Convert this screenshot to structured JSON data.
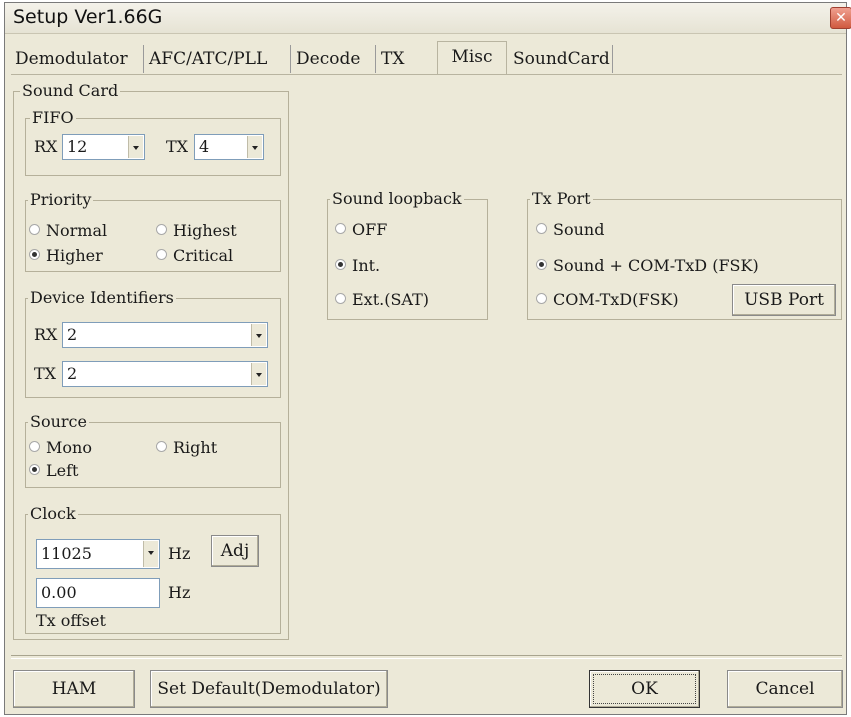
{
  "window": {
    "title": "Setup Ver1.66G"
  },
  "tabs": [
    "Demodulator",
    "AFC/ATC/PLL",
    "Decode",
    "TX",
    "Misc",
    "SoundCard"
  ],
  "sound_card": {
    "legend": "Sound Card",
    "fifo": {
      "legend": "FIFO",
      "rx_label": "RX",
      "rx_value": "12",
      "tx_label": "TX",
      "tx_value": "4"
    },
    "priority": {
      "legend": "Priority",
      "normal": "Normal",
      "highest": "Highest",
      "higher": "Higher",
      "critical": "Critical",
      "selected": "Higher"
    },
    "device_identifiers": {
      "legend": "Device Identifiers",
      "rx_label": "RX",
      "rx_value": "2",
      "tx_label": "TX",
      "tx_value": "2"
    },
    "source": {
      "legend": "Source",
      "mono": "Mono",
      "right": "Right",
      "left": "Left",
      "selected": "Left"
    },
    "clock": {
      "legend": "Clock",
      "value": "11025",
      "unit": "Hz",
      "adj_label": "Adj",
      "offset_value": "0.00",
      "offset_unit": "Hz",
      "offset_caption": "Tx offset"
    }
  },
  "sound_loopback": {
    "legend": "Sound loopback",
    "off": "OFF",
    "int": "Int.",
    "ext": "Ext.(SAT)",
    "selected": "Int."
  },
  "tx_port": {
    "legend": "Tx Port",
    "sound": "Sound",
    "sound_com": "Sound + COM-TxD (FSK)",
    "com": "COM-TxD(FSK)",
    "usb_label": "USB Port",
    "selected": "Sound + COM-TxD (FSK)"
  },
  "footer": {
    "ham": "HAM",
    "set_default": "Set Default(Demodulator)",
    "ok": "OK",
    "cancel": "Cancel"
  }
}
